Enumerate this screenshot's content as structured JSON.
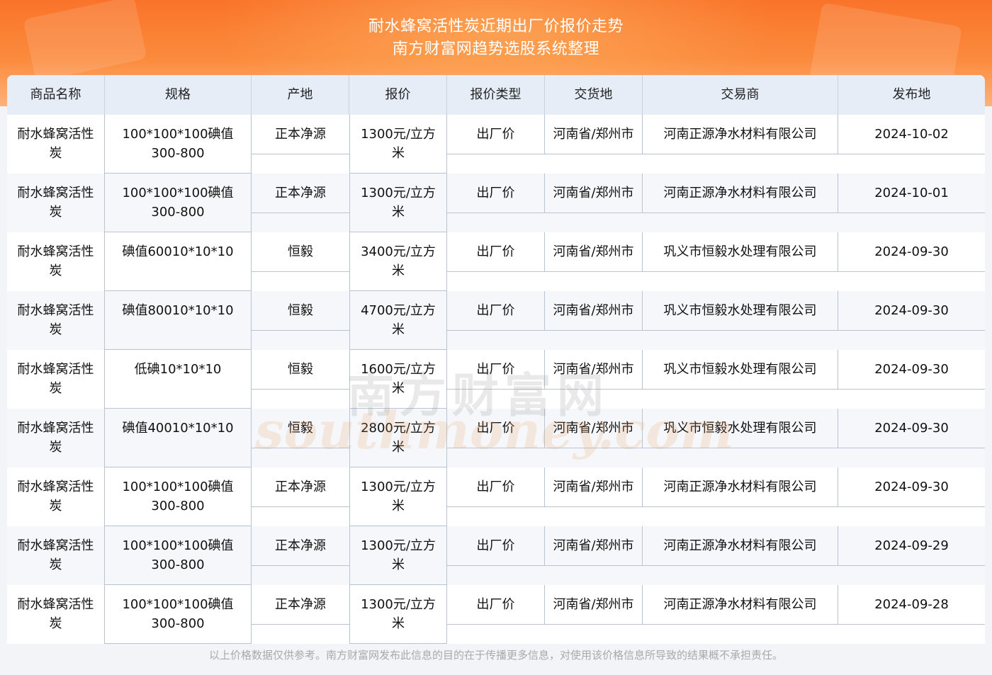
{
  "header": {
    "title_line1": "耐水蜂窝活性炭近期出厂价报价走势",
    "title_line2": "南方财富网趋势选股系统整理"
  },
  "table": {
    "columns": [
      "商品名称",
      "规格",
      "产地",
      "报价",
      "报价类型",
      "交货地",
      "交易商",
      "发布地"
    ],
    "rows": [
      {
        "name_l1": "耐水蜂窝活性",
        "name_l2": "炭",
        "spec_l1": "100*100*100碘值",
        "spec_l2": "300-800",
        "origin": "正本净源",
        "price_l1": "1300元/立方",
        "price_l2": "米",
        "type": "出厂价",
        "delivery": "河南省/郑州市",
        "trader": "河南正源净水材料有限公司",
        "date": "2024-10-02"
      },
      {
        "name_l1": "耐水蜂窝活性",
        "name_l2": "炭",
        "spec_l1": "100*100*100碘值",
        "spec_l2": "300-800",
        "origin": "正本净源",
        "price_l1": "1300元/立方",
        "price_l2": "米",
        "type": "出厂价",
        "delivery": "河南省/郑州市",
        "trader": "河南正源净水材料有限公司",
        "date": "2024-10-01"
      },
      {
        "name_l1": "耐水蜂窝活性",
        "name_l2": "炭",
        "spec_l1": "碘值60010*10*10",
        "spec_l2": "",
        "origin": "恒毅",
        "price_l1": "3400元/立方",
        "price_l2": "米",
        "type": "出厂价",
        "delivery": "河南省/郑州市",
        "trader": "巩义市恒毅水处理有限公司",
        "date": "2024-09-30"
      },
      {
        "name_l1": "耐水蜂窝活性",
        "name_l2": "炭",
        "spec_l1": "碘值80010*10*10",
        "spec_l2": "",
        "origin": "恒毅",
        "price_l1": "4700元/立方",
        "price_l2": "米",
        "type": "出厂价",
        "delivery": "河南省/郑州市",
        "trader": "巩义市恒毅水处理有限公司",
        "date": "2024-09-30"
      },
      {
        "name_l1": "耐水蜂窝活性",
        "name_l2": "炭",
        "spec_l1": "低碘10*10*10",
        "spec_l2": "",
        "origin": "恒毅",
        "price_l1": "1600元/立方",
        "price_l2": "米",
        "type": "出厂价",
        "delivery": "河南省/郑州市",
        "trader": "巩义市恒毅水处理有限公司",
        "date": "2024-09-30"
      },
      {
        "name_l1": "耐水蜂窝活性",
        "name_l2": "炭",
        "spec_l1": "碘值40010*10*10",
        "spec_l2": "",
        "origin": "恒毅",
        "price_l1": "2800元/立方",
        "price_l2": "米",
        "type": "出厂价",
        "delivery": "河南省/郑州市",
        "trader": "巩义市恒毅水处理有限公司",
        "date": "2024-09-30"
      },
      {
        "name_l1": "耐水蜂窝活性",
        "name_l2": "炭",
        "spec_l1": "100*100*100碘值",
        "spec_l2": "300-800",
        "origin": "正本净源",
        "price_l1": "1300元/立方",
        "price_l2": "米",
        "type": "出厂价",
        "delivery": "河南省/郑州市",
        "trader": "河南正源净水材料有限公司",
        "date": "2024-09-30"
      },
      {
        "name_l1": "耐水蜂窝活性",
        "name_l2": "炭",
        "spec_l1": "100*100*100碘值",
        "spec_l2": "300-800",
        "origin": "正本净源",
        "price_l1": "1300元/立方",
        "price_l2": "米",
        "type": "出厂价",
        "delivery": "河南省/郑州市",
        "trader": "河南正源净水材料有限公司",
        "date": "2024-09-29"
      },
      {
        "name_l1": "耐水蜂窝活性",
        "name_l2": "炭",
        "spec_l1": "100*100*100碘值",
        "spec_l2": "300-800",
        "origin": "正本净源",
        "price_l1": "1300元/立方",
        "price_l2": "米",
        "type": "出厂价",
        "delivery": "河南省/郑州市",
        "trader": "河南正源净水材料有限公司",
        "date": "2024-09-28"
      }
    ]
  },
  "watermark": {
    "cn": "南方财富网",
    "en": "southmoney.com"
  },
  "footer": {
    "disclaimer": "以上价格数据仅供参考。南方财富网发布此信息的目的在于传播更多信息，对使用该价格信息所导致的结果概不承担责任。"
  },
  "colors": {
    "banner": "#f9742a",
    "header_bg": "#e6edf7",
    "alt_row": "#f5f7fa",
    "border": "#b8c4d4"
  }
}
